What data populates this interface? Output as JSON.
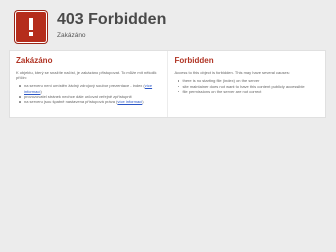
{
  "header": {
    "icon": "alert-exclamation-icon",
    "title": "403 Forbidden",
    "subtitle": "Zakázáno"
  },
  "colors": {
    "background": "#ececec",
    "accent": "#b03424",
    "icon_bg": "#b52d1c",
    "link": "#2a56c6"
  },
  "left": {
    "heading": "Zakázáno",
    "intro": "K objektu, který se snažíte načíst, je zakázáno přistupovat. To může mít několik příčin:",
    "items": [
      {
        "text": "na serveru není umístěn žádný zdrojový soubor prezentace - index (",
        "link": "více informací",
        "after": ")"
      },
      {
        "text": "provozovatel stránek nechce dále určovat veřejně zpřístupnit",
        "link": "",
        "after": ""
      },
      {
        "text": "na serveru jsou špatně nastavena přístupová práva (",
        "link": "více informací",
        "after": ")"
      }
    ]
  },
  "right": {
    "heading": "Forbidden",
    "intro": "Access to this object is forbidden. This may have several causes:",
    "items": [
      {
        "text": "there is no starting file (index) on the server"
      },
      {
        "text": "site maintainer does not want to have this content publicly accessible"
      },
      {
        "text": "file permissions on the server are not correct"
      }
    ]
  }
}
